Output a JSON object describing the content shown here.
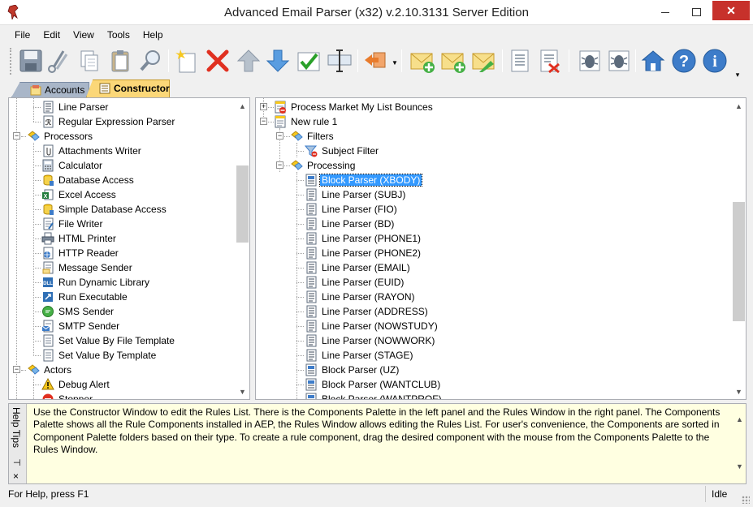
{
  "window": {
    "title": "Advanced Email Parser (x32) v.2.10.3131 Server Edition"
  },
  "menu": [
    "File",
    "Edit",
    "View",
    "Tools",
    "Help"
  ],
  "toolbar": {
    "buttons": [
      "save-icon",
      "cut-icon",
      "copy-icon",
      "paste-icon",
      "find-icon",
      "new-icon",
      "delete-icon",
      "move-up-icon",
      "move-down-icon",
      "check-icon",
      "rename-icon",
      "import-icon",
      "new-account-icon",
      "new-account-copy-icon",
      "edit-account-icon",
      "log-icon",
      "clear-log-icon",
      "debug-icon",
      "debug-settings-icon",
      "home-icon",
      "help-icon",
      "info-icon"
    ]
  },
  "tabs": {
    "accounts": "Accounts",
    "constructor": "Constructor"
  },
  "palette": {
    "items": [
      {
        "label": "Line Parser",
        "level": 2,
        "icon": "line-parser-icon"
      },
      {
        "label": "Regular Expression Parser",
        "level": 2,
        "icon": "regex-parser-icon"
      },
      {
        "label": "Processors",
        "level": 1,
        "icon": "folder-icon",
        "expanded": true
      },
      {
        "label": "Attachments Writer",
        "level": 2,
        "icon": "attachment-icon"
      },
      {
        "label": "Calculator",
        "level": 2,
        "icon": "calculator-icon"
      },
      {
        "label": "Database Access",
        "level": 2,
        "icon": "database-icon"
      },
      {
        "label": "Excel Access",
        "level": 2,
        "icon": "excel-icon"
      },
      {
        "label": "Simple Database Access",
        "level": 2,
        "icon": "database-icon"
      },
      {
        "label": "File Writer",
        "level": 2,
        "icon": "file-writer-icon"
      },
      {
        "label": "HTML Printer",
        "level": 2,
        "icon": "printer-icon"
      },
      {
        "label": "HTTP Reader",
        "level": 2,
        "icon": "http-icon"
      },
      {
        "label": "Message Sender",
        "level": 2,
        "icon": "message-icon"
      },
      {
        "label": "Run Dynamic Library",
        "level": 2,
        "icon": "dll-icon"
      },
      {
        "label": "Run Executable",
        "level": 2,
        "icon": "exe-icon"
      },
      {
        "label": "SMS Sender",
        "level": 2,
        "icon": "sms-icon"
      },
      {
        "label": "SMTP Sender",
        "level": 2,
        "icon": "smtp-icon"
      },
      {
        "label": "Set Value By File Template",
        "level": 2,
        "icon": "template-icon"
      },
      {
        "label": "Set Value By Template",
        "level": 2,
        "icon": "template-icon"
      },
      {
        "label": "Actors",
        "level": 1,
        "icon": "folder-icon",
        "expanded": true
      },
      {
        "label": "Debug Alert",
        "level": 2,
        "icon": "warning-icon"
      },
      {
        "label": "Stopper",
        "level": 2,
        "icon": "stop-icon"
      }
    ]
  },
  "rules": {
    "items": [
      {
        "label": "Process Market My List Bounces",
        "level": 0,
        "icon": "rule-disabled-icon",
        "expander": "+"
      },
      {
        "label": "New rule 1",
        "level": 0,
        "icon": "rule-icon",
        "expander": "-"
      },
      {
        "label": "Filters",
        "level": 1,
        "icon": "folder-icon",
        "expander": "-"
      },
      {
        "label": "Subject Filter",
        "level": 2,
        "icon": "filter-icon"
      },
      {
        "label": "Processing",
        "level": 1,
        "icon": "folder-icon",
        "expander": "-"
      },
      {
        "label": "Block Parser (XBODY)",
        "level": 2,
        "icon": "block-parser-icon",
        "selected": true
      },
      {
        "label": "Line Parser (SUBJ)",
        "level": 2,
        "icon": "line-parser-icon"
      },
      {
        "label": "Line Parser (FIO)",
        "level": 2,
        "icon": "line-parser-icon"
      },
      {
        "label": "Line Parser (BD)",
        "level": 2,
        "icon": "line-parser-icon"
      },
      {
        "label": "Line Parser (PHONE1)",
        "level": 2,
        "icon": "line-parser-icon"
      },
      {
        "label": "Line Parser (PHONE2)",
        "level": 2,
        "icon": "line-parser-icon"
      },
      {
        "label": "Line Parser (EMAIL)",
        "level": 2,
        "icon": "line-parser-icon"
      },
      {
        "label": "Line Parser (EUID)",
        "level": 2,
        "icon": "line-parser-icon"
      },
      {
        "label": "Line Parser (RAYON)",
        "level": 2,
        "icon": "line-parser-icon"
      },
      {
        "label": "Line Parser (ADDRESS)",
        "level": 2,
        "icon": "line-parser-icon"
      },
      {
        "label": "Line Parser (NOWSTUDY)",
        "level": 2,
        "icon": "line-parser-icon"
      },
      {
        "label": "Line Parser (NOWWORK)",
        "level": 2,
        "icon": "line-parser-icon"
      },
      {
        "label": "Line Parser (STAGE)",
        "level": 2,
        "icon": "line-parser-icon"
      },
      {
        "label": "Block Parser (UZ)",
        "level": 2,
        "icon": "block-parser-icon"
      },
      {
        "label": "Block Parser (WANTCLUB)",
        "level": 2,
        "icon": "block-parser-icon"
      },
      {
        "label": "Block Parser (WANTPROF)",
        "level": 2,
        "icon": "block-parser-icon"
      }
    ]
  },
  "help": {
    "tab_label": "Help Tips",
    "pin": "⊣",
    "close": "×",
    "text": "Use the Constructor Window to edit the Rules List. There is the Components Palette in the left panel and the Rules Window in the right panel. The Components Palette shows all the Rule Components installed in AEP, the Rules Window allows editing the Rules List. For user's convenience, the Components are sorted in Component Palette folders based on their type. To create a rule component, drag the desired component with the mouse from the Components Palette to the Rules Window."
  },
  "status": {
    "left": "For Help, press F1",
    "right": "Idle"
  },
  "colors": {
    "selection": "#3399ff",
    "tab_active": "#fbd778",
    "help_bg": "#ffffe1",
    "close_button": "#c7312b"
  }
}
